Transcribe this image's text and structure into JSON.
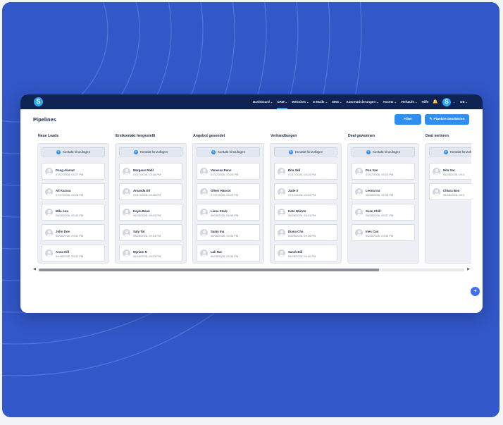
{
  "app": {
    "logo_letter": "S"
  },
  "nav": {
    "items": [
      {
        "label": "Dashboard",
        "dropdown": true,
        "active": false
      },
      {
        "label": "CRM",
        "dropdown": true,
        "active": true
      },
      {
        "label": "Websites",
        "dropdown": true,
        "active": false
      },
      {
        "label": "E-Mails",
        "dropdown": true,
        "active": false
      },
      {
        "label": "SMS",
        "dropdown": true,
        "active": false
      },
      {
        "label": "Automatisierungen",
        "dropdown": true,
        "active": false
      },
      {
        "label": "Assets",
        "dropdown": true,
        "active": false
      },
      {
        "label": "Verkäufe",
        "dropdown": true,
        "active": false
      },
      {
        "label": "Hilfe",
        "dropdown": false,
        "active": false
      }
    ],
    "user_avatar_letter": "S",
    "language": "DE"
  },
  "page": {
    "title": "Pipelines"
  },
  "toolbar": {
    "filter_label": "Filter",
    "edit_label": "Pipeline bearbeiten"
  },
  "add_contact_label": "Kontakt hinzufügen",
  "columns": [
    {
      "title": "Neue Leads",
      "cards": [
        {
          "name": "Pong Alamat",
          "date": "07/17/2026, 03:27 PM"
        },
        {
          "name": "Ali Karaca",
          "date": "07/17/2026, 03:26 PM"
        },
        {
          "name": "Mila Anu",
          "date": "06/28/2026, 09:40 PM"
        },
        {
          "name": "John Doe",
          "date": "06/28/2026, 09:32 PM"
        },
        {
          "name": "Anna Hill",
          "date": "06/28/2026, 09:32 PM"
        }
      ]
    },
    {
      "title": "Erstkontakt hergestellt",
      "cards": [
        {
          "name": "Margaux Rabl",
          "date": "07/17/2026, 03:26 PM"
        },
        {
          "name": "Amanda Eli",
          "date": "07/17/2026, 03:25 PM"
        },
        {
          "name": "Kayla Bean",
          "date": "06/28/2026, 09:32 PM"
        },
        {
          "name": "Saly Tat",
          "date": "06/28/2026, 09:33 PM"
        },
        {
          "name": "Myriam N",
          "date": "06/28/2026, 09:33 PM"
        }
      ]
    },
    {
      "title": "Angebot gesendet",
      "cards": [
        {
          "name": "Vanessa Pano",
          "date": "07/17/2026, 03:25 PM"
        },
        {
          "name": "Oliver Hancot",
          "date": "07/17/2026, 03:24 PM"
        },
        {
          "name": "Liana Stark",
          "date": "06/28/2026, 09:39 PM"
        },
        {
          "name": "Samy Ina",
          "date": "06/28/2026, 09:35 PM"
        },
        {
          "name": "Lali Nar",
          "date": "06/28/2026, 09:35 PM"
        }
      ]
    },
    {
      "title": "Verhandlungen",
      "cards": [
        {
          "name": "Rita Skil",
          "date": "07/17/2026, 03:24 PM"
        },
        {
          "name": "Jude II",
          "date": "07/17/2026, 03:23 PM"
        },
        {
          "name": "Kate Wiston",
          "date": "06/28/2026, 09:41 PM"
        },
        {
          "name": "Diana Cha",
          "date": "06/28/2026, 09:36 PM"
        },
        {
          "name": "Sarah Bili",
          "date": "06/28/2026, 09:30 PM"
        }
      ]
    },
    {
      "title": "Deal gewonnen",
      "cards": [
        {
          "name": "Pon Van",
          "date": "07/17/2026, 03:23 PM"
        },
        {
          "name": "Leona Ina",
          "date": "06/28/2026, 09:38 PM"
        },
        {
          "name": "Sean Chill",
          "date": "06/28/2026, 09:37 PM"
        },
        {
          "name": "Ines Can",
          "date": "06/28/2026, 09:36 PM"
        }
      ]
    },
    {
      "title": "Deal verloren",
      "cards": [
        {
          "name": "Nita Sar",
          "date": "06/28/2026, 09:4"
        },
        {
          "name": "Chiara Boo",
          "date": "06/28/2026, 09:3"
        }
      ]
    }
  ],
  "scroll": {
    "position_fraction": 0.8
  },
  "colors": {
    "topbar": "#0e2352",
    "accent": "#2f8ef0",
    "background": "#3257c8"
  }
}
